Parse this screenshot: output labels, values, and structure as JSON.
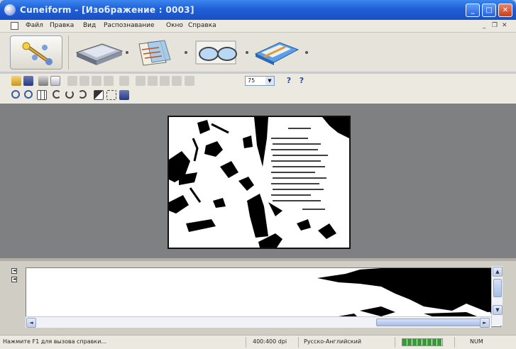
{
  "window": {
    "title": "Cuneiform - [Изображение : 0003]",
    "minimize_glyph": "_",
    "maximize_glyph": "□",
    "close_glyph": "✕"
  },
  "menu": {
    "items": [
      "Файл",
      "Правка",
      "Вид",
      "Распознавание",
      "Окно",
      "Справка"
    ],
    "mdi_minimize": "_",
    "mdi_restore": "❐",
    "mdi_close": "✕"
  },
  "big_toolbar": {
    "icons": [
      "wizard-icon",
      "scanner-icon",
      "layout-icon",
      "glasses-icon",
      "export-icon"
    ]
  },
  "toolbar": {
    "zoom_value": "75",
    "zoom_arrow": "▼",
    "help_glyph": "?",
    "context_help_glyph": "?"
  },
  "view_toolbar": {
    "icons": [
      "zoom-in-icon",
      "zoom-out-icon",
      "fit-grid-icon",
      "rotate-left-icon",
      "rotate-180-icon",
      "rotate-right-icon",
      "invert-icon",
      "fit-page-icon",
      "save-image-icon"
    ]
  },
  "left_markers": [
    "◄",
    "◄"
  ],
  "scroll": {
    "up": "▲",
    "down": "▼",
    "left": "◄",
    "right": "►"
  },
  "status": {
    "hint": "Нажмите F1 для вызова справки...",
    "dpi": "400:400 dpi",
    "language": "Русско-Английский",
    "num": "NUM",
    "progress": 1.0
  },
  "colors": {
    "titlebar": "#1f5fd6",
    "workspace": "#7f8081",
    "chrome": "#eceae0"
  }
}
